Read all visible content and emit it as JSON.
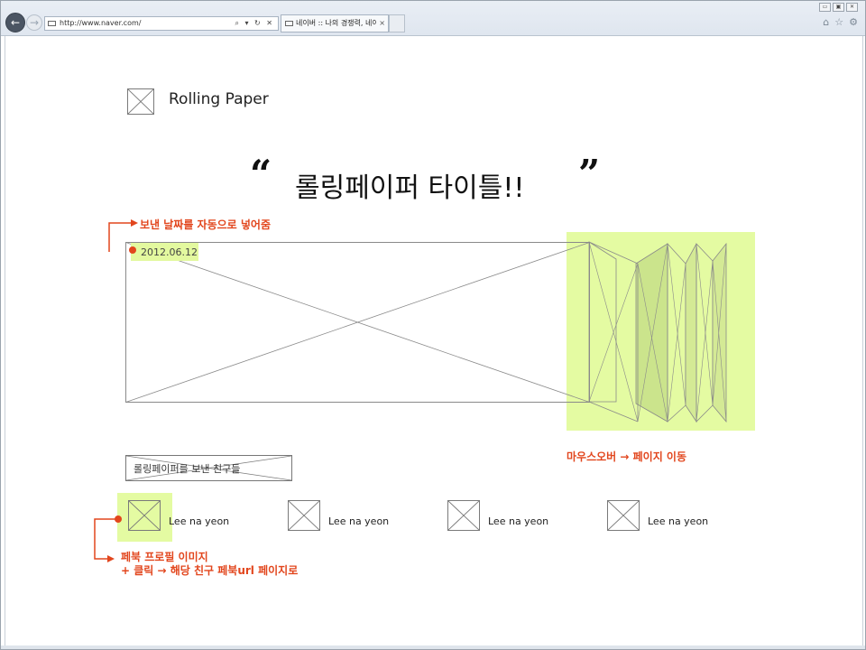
{
  "browser": {
    "address_url": "http://www.naver.com/",
    "address_tools": "⌕ ▾ ↻ ✕",
    "tab_title": "네이버 :: 나의 경쟁력, 네이...",
    "tab_close": "×",
    "back_icon": "←",
    "forward_icon": "→",
    "window_controls": [
      "▭",
      "▣",
      "✕"
    ],
    "right_icons": [
      "⌂",
      "☆",
      "⚙"
    ]
  },
  "page": {
    "logo_text": "Rolling Paper",
    "title_open_quote": "“",
    "title": "롤링페이퍼 타이틀!!",
    "title_close_quote": "”",
    "date": "2012.06.12",
    "friends_label": "롤링페이퍼를 보낸 친구들",
    "friends": [
      {
        "name": "Lee na yeon"
      },
      {
        "name": "Lee na yeon"
      },
      {
        "name": "Lee na yeon"
      },
      {
        "name": "Lee na yeon"
      }
    ]
  },
  "annotations": {
    "date_note": "보낸 날짜를 자동으로 넣어줌",
    "mouseover_note": "마우스오버 → 페이지 이동",
    "profile_note_line1": "페북 프로필 이미지",
    "profile_note_line2": "+ 클릭 → 해당 친구 페북url 페이지로"
  },
  "colors": {
    "highlight": "#e4fba2",
    "annotation": "#e2461d"
  }
}
